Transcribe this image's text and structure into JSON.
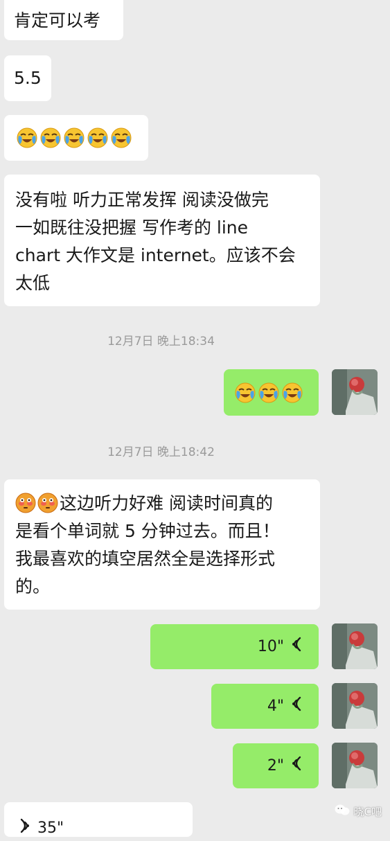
{
  "messages": {
    "m1": "肯定可以考",
    "m2": "5.5",
    "m4_lines": [
      "没有啦 听力正常发挥 阅读没做完",
      "一如既往没把握 写作考的 line",
      "chart 大作文是 internet。应该不会",
      "太低"
    ],
    "ts1": "12月7日 晚上18:34",
    "ts2": "12月7日 晚上18:42",
    "m6_lines": [
      "这边听力好难 阅读时间真的",
      "是看个单词就 5 分钟过去。而且！",
      "我最喜欢的填空居然全是选择形式",
      "的。"
    ],
    "voice1": "10\"",
    "voice2": "4\"",
    "voice3": "2\"",
    "voice4": "35\""
  },
  "emoji": {
    "crying_face": "crying-laughing-emoji",
    "flushed_face": "flushed-face-emoji"
  },
  "watermark": "晓C吧",
  "colors": {
    "background": "#ebebeb",
    "bubble_left": "#ffffff",
    "bubble_right": "#95ec69",
    "timestamp": "#9a9a9a"
  }
}
